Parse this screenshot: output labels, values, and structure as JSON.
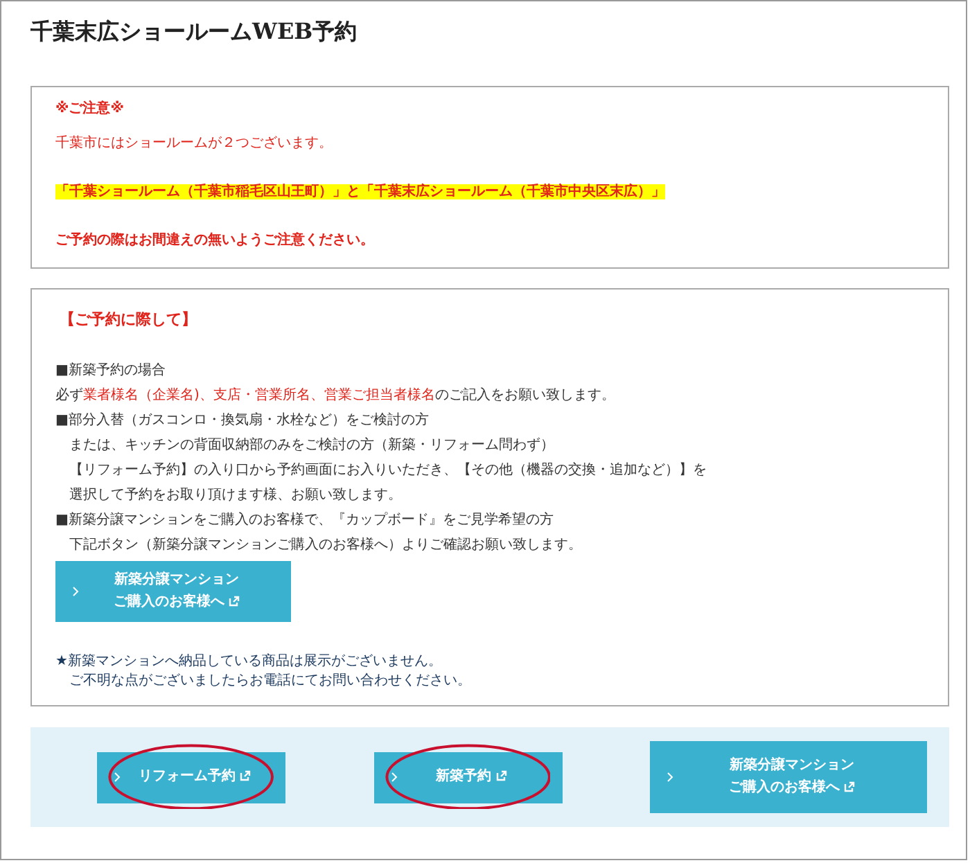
{
  "title": "千葉末広ショールームWEB予約",
  "notice": {
    "heading": "※ご注意※",
    "lines": [
      {
        "text": "千葉市にはショールームが２つございます。",
        "kind": "plain"
      },
      {
        "text": "「千葉ショールーム（千葉市稲毛区山王町）」と「千葉末広ショールーム（千葉市中央区末広）」",
        "kind": "highlight"
      },
      {
        "text": "ご予約の際はお間違えの無いようご注意ください。",
        "kind": "bold"
      }
    ]
  },
  "guide": {
    "heading": "【ご予約に際して】",
    "lines": [
      {
        "parts": [
          {
            "text": "■新築予約の場合",
            "red": false
          }
        ]
      },
      {
        "parts": [
          {
            "text": "必ず",
            "red": false
          },
          {
            "text": "業者様名（企業名)、支店・営業所名、営業ご担当者様名",
            "red": true
          },
          {
            "text": "のご記入をお願い致します。",
            "red": false
          }
        ]
      },
      {
        "parts": [
          {
            "text": "■部分入替（ガスコンロ・換気扇・水栓など）をご検討の方",
            "red": false
          }
        ]
      },
      {
        "parts": [
          {
            "text": "　または、キッチンの背面収納部のみをご検討の方（新築・リフォーム問わず）",
            "red": false
          }
        ]
      },
      {
        "parts": [
          {
            "text": "　【リフォーム予約】の入り口から予約画面にお入りいただき、【その他（機器の交換・追加など）】を",
            "red": false
          }
        ]
      },
      {
        "parts": [
          {
            "text": "　選択して予約をお取り頂けます様、お願い致します。",
            "red": false
          }
        ]
      },
      {
        "parts": [
          {
            "text": "■新築分譲マンションをご購入のお客様で、『カップボード』をご見学希望の方",
            "red": false
          }
        ]
      },
      {
        "parts": [
          {
            "text": "　下記ボタン（新築分譲マンションご購入のお客様へ）よりご確認お願い致します。",
            "red": false
          }
        ]
      }
    ],
    "button": {
      "lines": [
        "新築分譲マンション",
        "ご購入のお客様へ"
      ],
      "circled": false
    },
    "notes": [
      "★新築マンションへ納品している商品は展示がございません。",
      "　ご不明な点がございましたらお電話にてお問い合わせください。"
    ]
  },
  "buttons": [
    {
      "lines": [
        "リフォーム予約"
      ],
      "circled": true
    },
    {
      "lines": [
        "新築予約"
      ],
      "circled": true
    },
    {
      "lines": [
        "新築分譲マンション",
        "ご購入のお客様へ"
      ],
      "circled": false
    }
  ]
}
